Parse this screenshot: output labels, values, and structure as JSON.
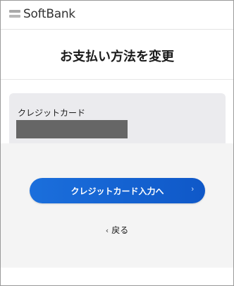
{
  "header": {
    "brand": "SoftBank",
    "logo_icon": "softbank-logo-icon"
  },
  "page": {
    "title": "お支払い方法を変更"
  },
  "payment": {
    "label": "クレジットカード",
    "masked_value_visible": false
  },
  "actions": {
    "primary_label": "クレジットカード入力へ",
    "primary_chevron": "›",
    "back_chevron": "‹",
    "back_label": "戻る"
  },
  "colors": {
    "primary": "#1b6fdc",
    "card_bg": "#ebebee",
    "mask": "#666666"
  }
}
